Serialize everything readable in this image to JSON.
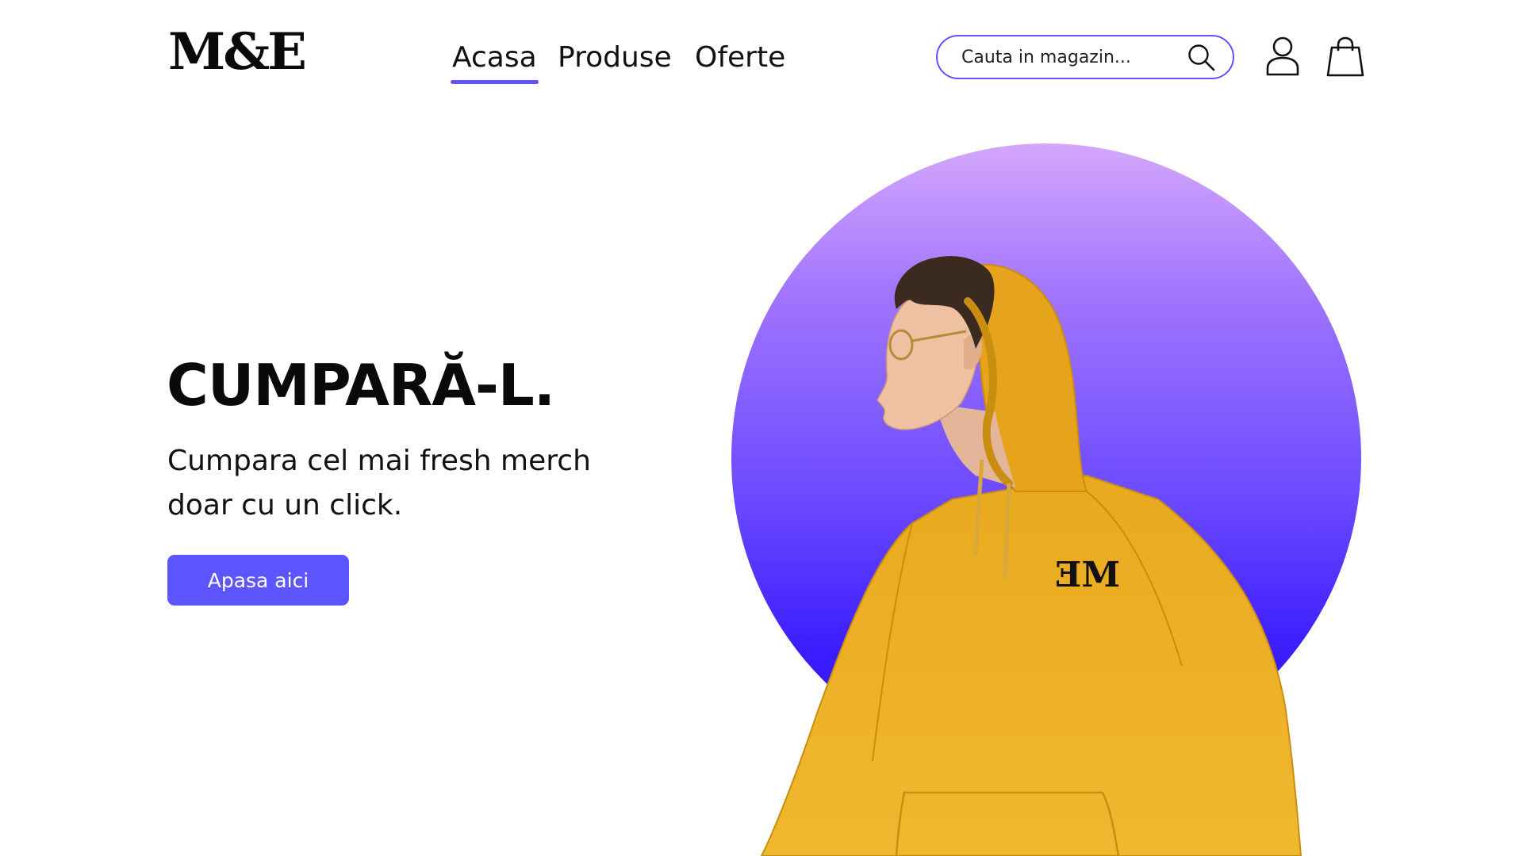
{
  "brand": {
    "logo_text": "M&E",
    "accent": "#5d55ff"
  },
  "nav": {
    "items": [
      {
        "label": "Acasa",
        "active": true
      },
      {
        "label": "Produse",
        "active": false
      },
      {
        "label": "Oferte",
        "active": false
      }
    ]
  },
  "search": {
    "placeholder": "Cauta in magazin...",
    "value": "",
    "icon": "search-icon"
  },
  "header_icons": {
    "account": "user-icon",
    "cart": "shopping-bag-icon"
  },
  "hero": {
    "title": "CUMPARĂ-L.",
    "subtitle_line1": "Cumpara cel mai fresh merch",
    "subtitle_line2": "doar cu un click.",
    "cta_label": "Apasa aici",
    "hoodie_logo": "ƎM",
    "circle_colors": [
      "#d4a7fb",
      "#2410f5"
    ],
    "hoodie_color": "#f2b52c"
  }
}
